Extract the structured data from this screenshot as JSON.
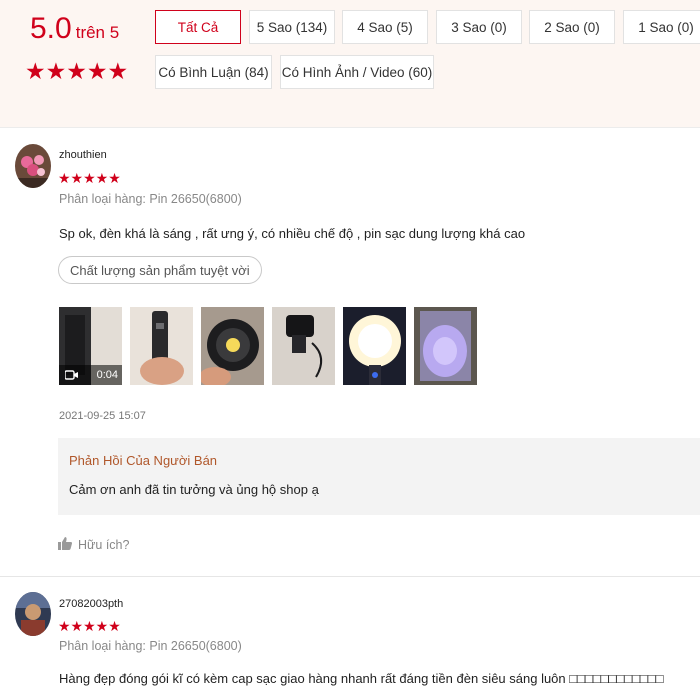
{
  "overview": {
    "score": "5.0",
    "score_suffix": "trên 5",
    "stars": "★★★★★",
    "filters": [
      {
        "label": "Tất Cả",
        "active": true
      },
      {
        "label": "5 Sao (134)"
      },
      {
        "label": "4 Sao (5)"
      },
      {
        "label": "3 Sao (0)"
      },
      {
        "label": "2 Sao (0)"
      },
      {
        "label": "1 Sao (0)"
      },
      {
        "label": "Có Bình Luận (84)"
      },
      {
        "label": "Có Hình Ảnh / Video (60)"
      }
    ]
  },
  "reviews": [
    {
      "username": "zhouthien",
      "stars": "★★★★★",
      "rating": 5,
      "variant": "Phân loại hàng: Pin 26650(6800)",
      "content": "Sp ok, đèn khá là sáng , rất ưng ý, có nhiều chế độ , pin sạc dung lượng khá cao",
      "tag": "Chất lượng sản phẩm tuyệt vời",
      "media": [
        {
          "type": "video",
          "duration": "0:04",
          "icon": "video-camera-icon"
        },
        {
          "type": "image"
        },
        {
          "type": "image"
        },
        {
          "type": "image"
        },
        {
          "type": "image"
        },
        {
          "type": "image"
        }
      ],
      "date": "2021-09-25 15:07",
      "seller_reply": {
        "title": "Phản Hồi Của Người Bán",
        "text": "Cảm ơn anh đã tin tưởng và ủng hộ shop ạ"
      },
      "helpful_label": "Hữu ích?",
      "helpful_icon": "thumbs-up-icon"
    },
    {
      "username": "27082003pth",
      "stars": "★★★★★",
      "rating": 5,
      "variant": "Phân loại hàng: Pin 26650(6800)",
      "content": "Hàng đẹp đóng gói kĩ có kèm cap sạc giao hàng nhanh rất đáng tiền đèn siêu sáng luôn □□□□□□□□□□□□"
    }
  ],
  "colors": {
    "accent": "#d0011b",
    "panel_bg": "#fdf6f2",
    "reply_bg": "#f3f3f3",
    "reply_title": "#b0572a"
  }
}
